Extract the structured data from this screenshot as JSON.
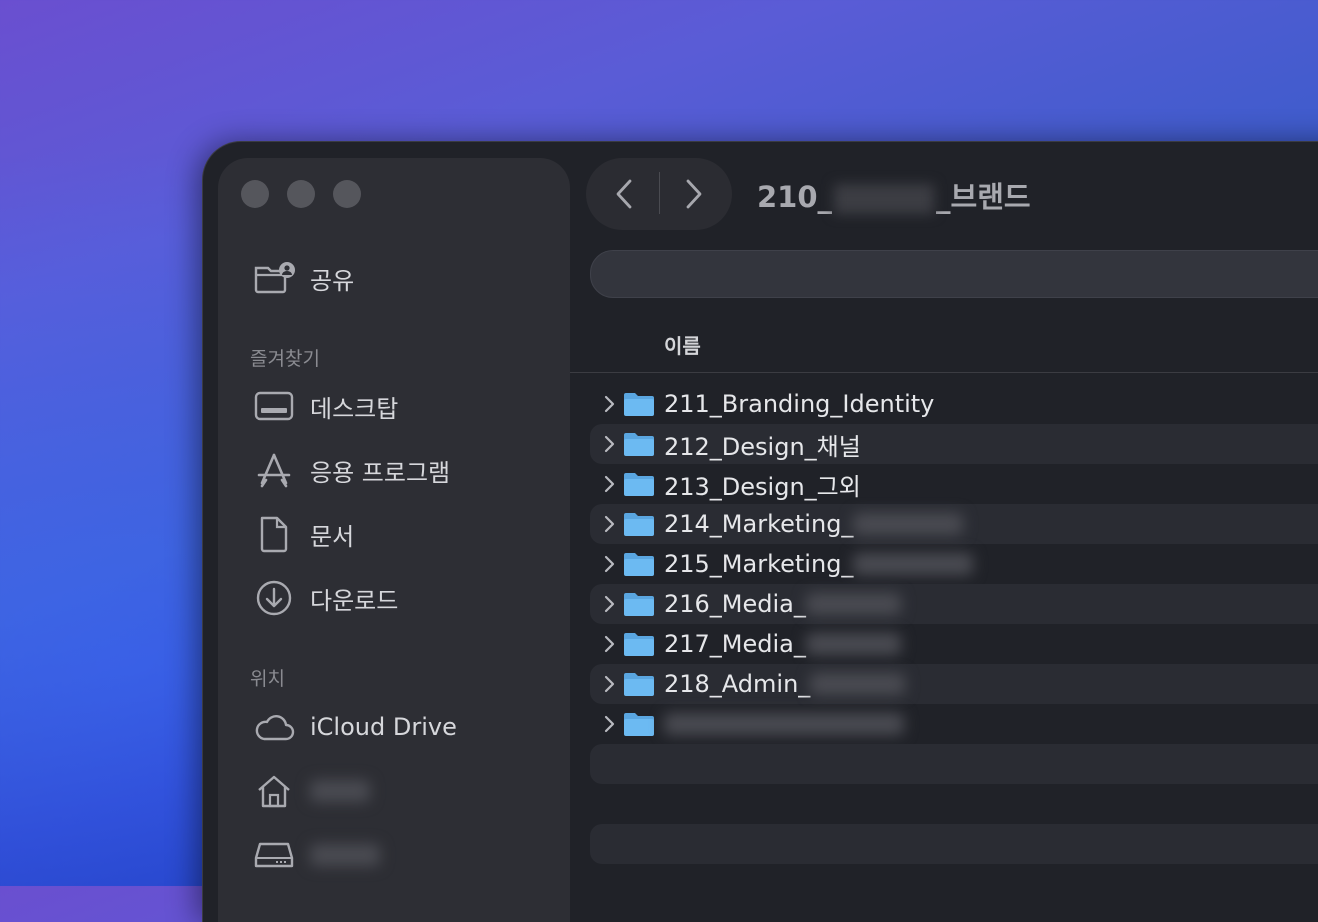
{
  "window": {
    "title_prefix": "210_",
    "title_suffix": "_브랜드"
  },
  "sidebar": {
    "shared_label": "공유",
    "favorites_header": "즐겨찾기",
    "favorites": [
      {
        "label": "데스크탑",
        "icon": "desktop-icon"
      },
      {
        "label": "응용 프로그램",
        "icon": "applications-icon"
      },
      {
        "label": "문서",
        "icon": "document-icon"
      },
      {
        "label": "다운로드",
        "icon": "download-icon"
      }
    ],
    "locations_header": "위치",
    "locations": [
      {
        "label": "iCloud Drive",
        "icon": "cloud-icon"
      },
      {
        "label": "",
        "icon": "home-icon"
      },
      {
        "label": "",
        "icon": "drive-icon"
      }
    ]
  },
  "toolbar": {
    "back_icon": "chevron-left-icon",
    "forward_icon": "chevron-right-icon"
  },
  "list": {
    "column_name": "이름",
    "folders": [
      {
        "name": "211_Branding_Identity"
      },
      {
        "name": "212_Design_채널"
      },
      {
        "name": "213_Design_그외"
      },
      {
        "name": "214_Marketing_"
      },
      {
        "name": "215_Marketing_"
      },
      {
        "name": "216_Media_"
      },
      {
        "name": "217_Media_"
      },
      {
        "name": "218_Admin_"
      },
      {
        "name": ""
      }
    ]
  },
  "colors": {
    "folder": "#63b3ee",
    "window_bg": "#202228",
    "sidebar_bg": "#2d2e34"
  }
}
